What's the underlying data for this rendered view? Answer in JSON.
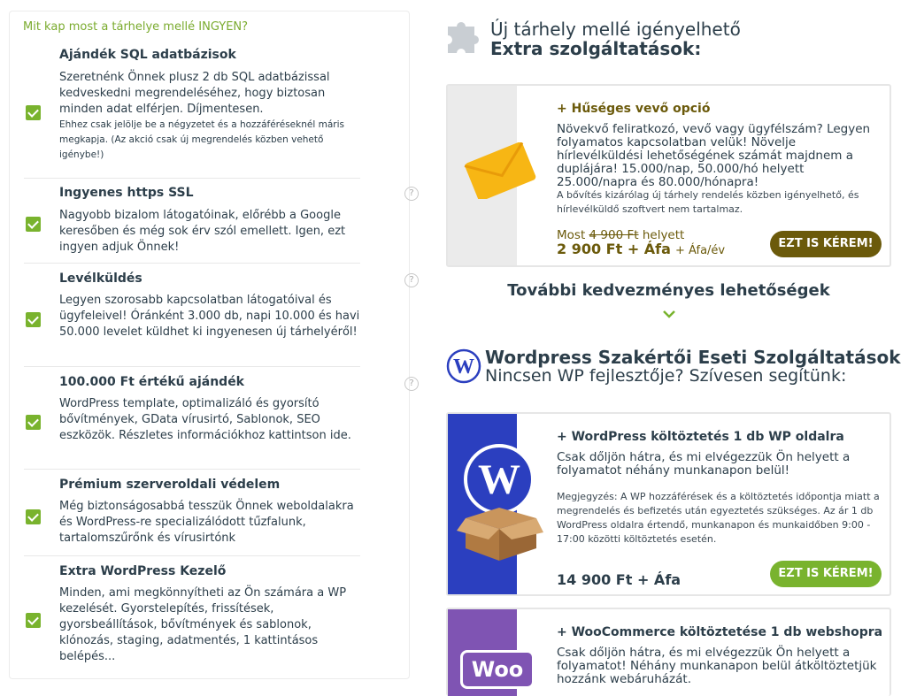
{
  "left_panel": {
    "heading": "Mit kap most a tárhelye mellé INGYEN?",
    "features": [
      {
        "title": "Ajándék SQL adatbázisok",
        "desc": "Szeretnénk Önnek plusz 2 db SQL adatbázissal kedveskedni megrendeléséhez, hogy biztosan minden adat elférjen. Díjmentesen.",
        "note": "Ehhez csak jelölje be a négyzetet és a hozzáféréseknél máris megkapja. (Az akció csak új megrendelés közben vehető igénybe!)",
        "checked": true
      },
      {
        "title": "Ingyenes https SSL",
        "desc": "Nagyobb bizalom látogatóinak, előrébb a Google keresőben és még sok érv szól emellett. Igen, ezt ingyen adjuk Önnek!",
        "help_icon": "?",
        "checked": true
      },
      {
        "title": "Levélküldés",
        "desc": "Legyen szorosabb kapcsolatban látogatóival és ügyfeleivel! Óránként 3.000 db, napi 10.000 és havi 50.000 levelet küldhet ki ingyenesen új tárhelyéről!",
        "help_icon": "?",
        "checked": true
      },
      {
        "title": "100.000 Ft értékű ajándék",
        "desc": "WordPress template, optimalizáló és gyorsító bővítmények, GData vírusirtó, Sablonok, SEO eszközök. Részletes információkhoz kattintson ide.",
        "help_icon": "?",
        "checked": true
      },
      {
        "title": "Prémium szerveroldali védelem",
        "desc": "Még biztonságosabbá tesszük Önnek weboldalakra és WordPress-re specializálódott tűzfalunk, tartalomszűrőnk és vírusirtónk",
        "checked": true
      },
      {
        "title": "Extra WordPress Kezelő",
        "desc": "Minden, ami megkönnyítheti az Ön számára a WP kezelését. Gyorstelepítés, frissítések, gyorsbeállítások, bővítmények és sablonok, klónozás, staging, adatmentés, 1 kattintásos belépés...",
        "checked": true
      }
    ]
  },
  "extras": {
    "title_line1": "Új tárhely mellé igényelhető",
    "title_line2": "Extra szolgáltatások:"
  },
  "loyalty_card": {
    "title": "+ Hűséges vevő opció",
    "body": "Növekvő feliratkozó, vevő vagy ügyfélszám? Legyen folyamatos kapcsolatban velük! Növelje hírlevélküldési lehetőségének számát majdnem a duplájára! 15.000/nap, 50.000/hó helyett 25.000/napra és 80.000/hónapra!",
    "small": "A bővítés kizárólag új tárhely rendelés közben igényelhető, és hírlevélküldő szoftvert nem tartalmaz.",
    "price_prefix": "Most",
    "old_price": "4 900 Ft",
    "price_suffix": "helyett",
    "price": "2 900 Ft + Áfa",
    "period": "+ Áfa/év",
    "button": "EZT IS KÉREM!",
    "icon": "envelope-icon"
  },
  "more_options": {
    "label": "További kedvezményes lehetőségek"
  },
  "wordpress_section": {
    "title": "Wordpress Szakértői Eseti Szolgáltatások",
    "subtitle": "Nincsen WP fejlesztője? Szívesen segítünk:"
  },
  "wp_move_card": {
    "title": "+ WordPress költöztetés 1 db WP oldalra",
    "body": "Csak dőljön hátra, és mi elvégezzük Ön helyett a folyamatot néhány munkanapon belül!",
    "small": "Megjegyzés: A WP hozzáférések és a költöztetés időpontja miatt a megrendelés és befizetés után egyeztetés szükséges. Az ár 1 db WordPress oldalra értendő, munkanapon és munkaidőben 9:00 - 17:00 közötti költöztetés esetén.",
    "price": "14 900 Ft + Áfa",
    "button": "EZT IS KÉREM!",
    "accent": "#2b3fbf"
  },
  "woo_card": {
    "title": "+ WooCommerce költöztetése 1 db webshopra",
    "body": "Csak dőljön hátra, és mi elvégezzük Ön helyett a folyamatot! Néhány munkanapon belül átköltöztetjük hozzánk webáruházát.",
    "logo_text": "Woo",
    "accent": "#7f54b3"
  },
  "colors": {
    "green": "#79b32e",
    "olive": "#6b5a0b",
    "text": "#2c3e4a"
  }
}
